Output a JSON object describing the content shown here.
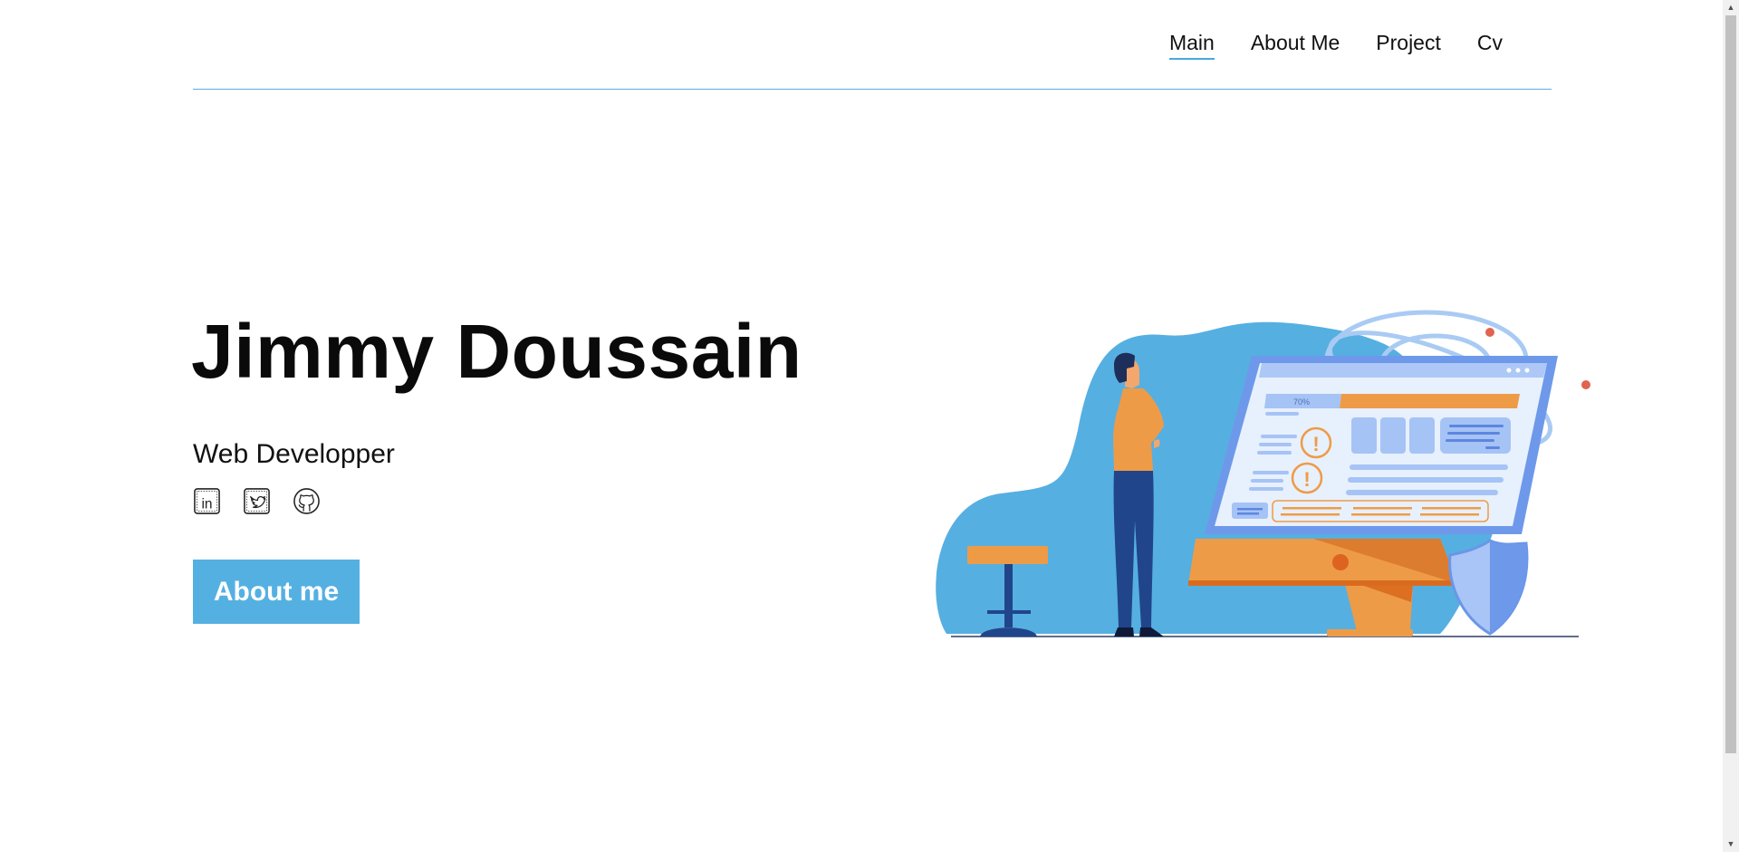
{
  "nav": {
    "items": [
      {
        "label": "Main",
        "active": true
      },
      {
        "label": "About Me",
        "active": false
      },
      {
        "label": "Project",
        "active": false
      },
      {
        "label": "Cv",
        "active": false
      }
    ]
  },
  "hero": {
    "name": "Jimmy Doussain",
    "role": "Web Developper",
    "cta_label": "About me"
  },
  "socials": [
    {
      "icon": "linkedin-icon",
      "text": "in"
    },
    {
      "icon": "twitter-icon"
    },
    {
      "icon": "github-icon"
    }
  ],
  "illustration": {
    "progress_label": "70%"
  },
  "colors": {
    "accent": "#55b0e2",
    "nav_border": "#5aafe0",
    "illustration_blue": "#56afe1",
    "illustration_orange": "#f0a04b",
    "illustration_dark": "#21458a"
  }
}
